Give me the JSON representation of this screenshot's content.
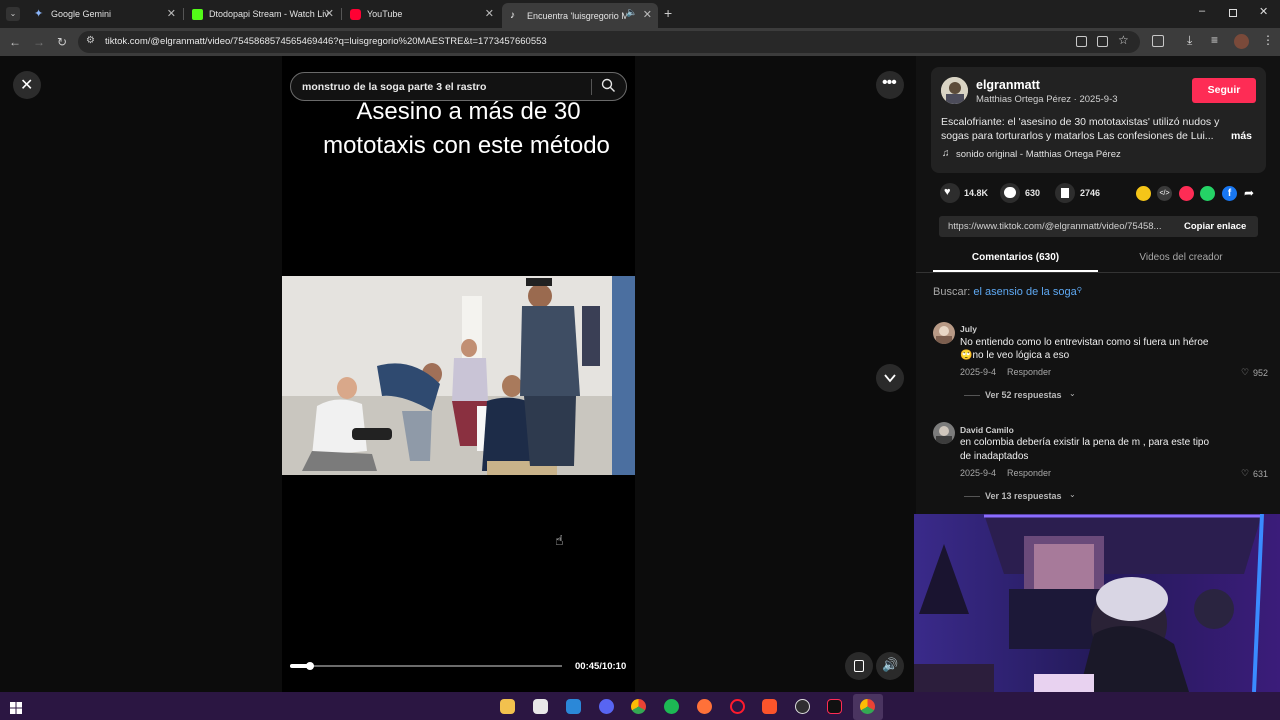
{
  "browser": {
    "tabs": [
      {
        "title": "Google Gemini",
        "favicon_color": "#8ab4f8"
      },
      {
        "title": "Dtodopapi Stream - Watch Live",
        "favicon_color": "#53fc18"
      },
      {
        "title": "YouTube",
        "favicon_color": "#ff0033"
      },
      {
        "title": "Encuentra 'luisgregorio MAES…",
        "favicon_color": "#e0e0e0"
      }
    ],
    "url": "tiktok.com/@elgranmatt/video/7545868574565469446?q=luisgregorio%20MAESTRE&t=1773457660553"
  },
  "player": {
    "search_query": "monstruo de la soga parte 3 el rastro",
    "caption_line1": "Asesino a más de 30",
    "caption_line2": "mototaxis con este método",
    "time": "00:45/10:10",
    "progress": 0.074
  },
  "creator": {
    "username": "elgranmatt",
    "subline": "Matthias Ortega Pérez · 2025-9-3",
    "follow_label": "Seguir",
    "description_line1": "Escalofriante: el 'asesino de 30 mototaxistas' utilizó nudos y",
    "description_line2": "sogas para torturarlos y matarlos Las confesiones de Lui...",
    "more_label": "más",
    "music": "sonido original - Matthias Ortega Pérez"
  },
  "stats": {
    "likes": "14.8K",
    "comments": "630",
    "saves": "2746"
  },
  "link": {
    "url_text": "https://www.tiktok.com/@elgranmatt/video/75458...",
    "copy_label": "Copiar enlace"
  },
  "tabs": {
    "comments_label": "Comentarios (630)",
    "creator_videos_label": "Videos del creador"
  },
  "search_suggest": {
    "prefix": "Buscar:",
    "term": "el asensio de la soga"
  },
  "comments": [
    {
      "author": "July",
      "text_line1": "No entiendo como lo entrevistan como si fuera un héroe",
      "text_line2": "🙄no le veo lógica a eso",
      "date": "2025-9-4",
      "reply_label": "Responder",
      "likes": "952",
      "replies_label": "Ver 52 respuestas"
    },
    {
      "author": "David Camilo",
      "text_line1": "en colombia debería existir la pena de m , para este tipo",
      "text_line2": "de inadaptados",
      "date": "2025-9-4",
      "reply_label": "Responder",
      "likes": "631",
      "replies_label": "Ver 13 respuestas"
    }
  ],
  "colors": {
    "follow": "#fe2c55",
    "search_term": "#5ea8f2",
    "taskbar": "#2b1642"
  }
}
